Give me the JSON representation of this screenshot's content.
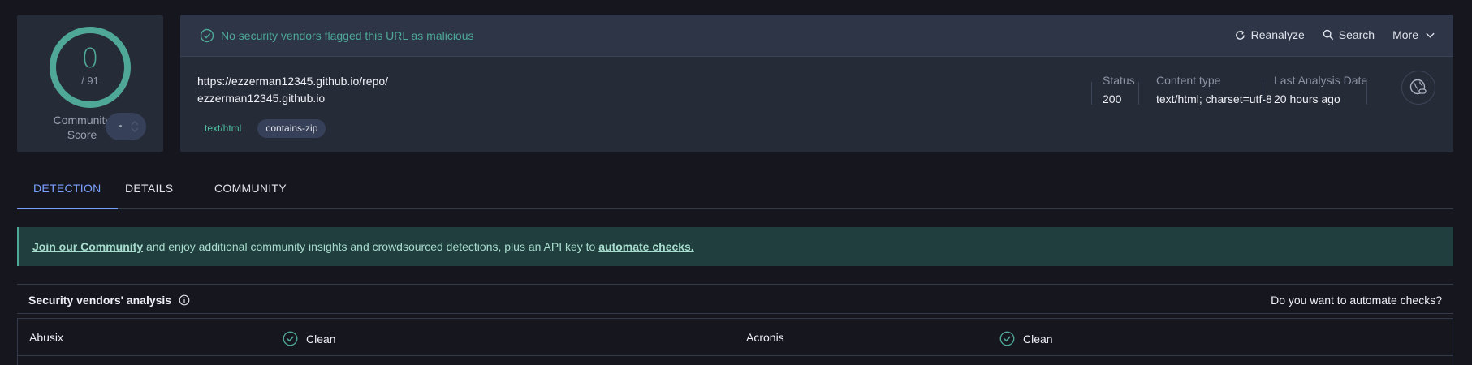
{
  "score": {
    "detections": "0",
    "total": "/ 91",
    "community_label": "Community\nScore"
  },
  "header": {
    "flag_message": "No security vendors flagged this URL as malicious",
    "actions": {
      "reanalyze": "Reanalyze",
      "search": "Search",
      "more": "More"
    }
  },
  "target": {
    "url": "https://ezzerman12345.github.io/repo/",
    "domain": "ezzerman12345.github.io",
    "tags": [
      "text/html",
      "contains-zip"
    ]
  },
  "meta": {
    "status_label": "Status",
    "status_value": "200",
    "content_type_label": "Content type",
    "content_type_value": "text/html; charset=utf-8",
    "last_analysis_label": "Last Analysis Date",
    "last_analysis_value": "20 hours ago"
  },
  "tabs": [
    {
      "label": "DETECTION",
      "active": true
    },
    {
      "label": "DETAILS",
      "active": false
    },
    {
      "label": "COMMUNITY",
      "active": false
    }
  ],
  "banner": {
    "link1": "Join our Community",
    "text": " and enjoy additional community insights and crowdsourced detections, plus an API key to ",
    "link2": "automate checks."
  },
  "analysis": {
    "title": "Security vendors' analysis",
    "automate_question": "Do you want to automate checks?",
    "rows": [
      {
        "vendor1": "Abusix",
        "result1": "Clean",
        "vendor2": "Acronis",
        "result2": "Clean"
      }
    ]
  },
  "colors": {
    "accent_green": "#4fa897",
    "accent_blue": "#7aa0ff",
    "background": "#16161f",
    "panel": "#262b38"
  },
  "icons": {
    "ring": "score-ring",
    "check": "check-circle-icon",
    "reanalyze": "refresh-icon",
    "search": "search-icon",
    "more": "chevron-down-icon",
    "info": "info-icon",
    "globe": "globe-link-icon"
  }
}
